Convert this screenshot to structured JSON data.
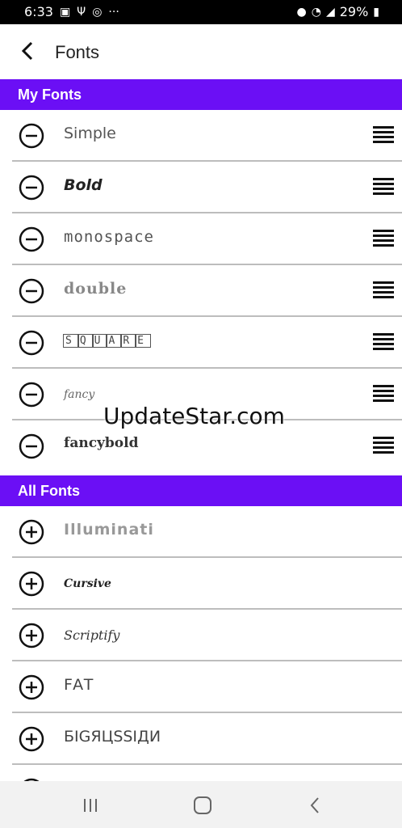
{
  "status_bar": {
    "time": "6:33",
    "left_icons": [
      "image-icon",
      "usb-icon",
      "instagram-icon",
      "more-dots-icon"
    ],
    "battery": "29%",
    "right_icons": [
      "location-icon",
      "wifi-icon",
      "signal-icon",
      "battery-icon"
    ]
  },
  "appbar": {
    "title": "Fonts"
  },
  "my_fonts": {
    "header": "My Fonts",
    "items": [
      {
        "label": "Simple",
        "style": "simple"
      },
      {
        "label": "Bold",
        "style": "bold"
      },
      {
        "label": "monospace",
        "style": "mono"
      },
      {
        "label": "double",
        "style": "double"
      },
      {
        "label": "SQUARE",
        "style": "square"
      },
      {
        "label": "fancy",
        "style": "fancy"
      },
      {
        "label": "fancybold",
        "style": "fancybold"
      }
    ]
  },
  "all_fonts": {
    "header": "All Fonts",
    "items": [
      {
        "label": "Illuminati",
        "style": "illum"
      },
      {
        "label": "Cursive",
        "style": "cursive"
      },
      {
        "label": "Scriptify",
        "style": "script"
      },
      {
        "label": "FAT",
        "style": "fat"
      },
      {
        "label": "БIGЯЦSSIДИ",
        "style": "big"
      }
    ]
  },
  "watermark": "UpdateStar.com",
  "colors": {
    "accent": "#6b0ff5"
  }
}
